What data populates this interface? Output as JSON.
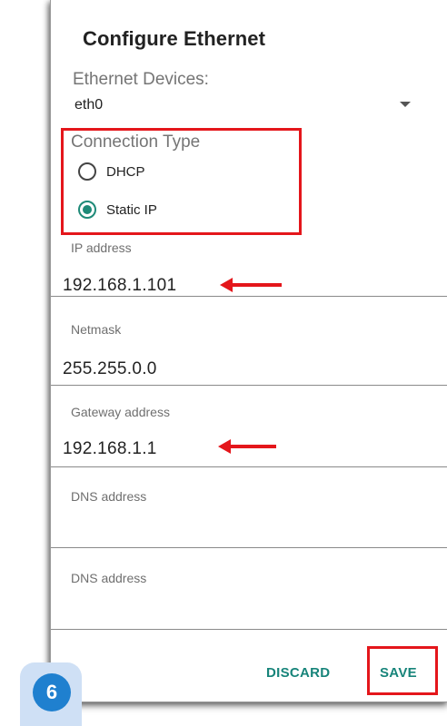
{
  "dialog": {
    "title": "Configure Ethernet",
    "devices_label": "Ethernet Devices:",
    "devices_value": "eth0",
    "connection_type_label": "Connection Type",
    "options": [
      {
        "label": "DHCP",
        "checked": false
      },
      {
        "label": "Static IP",
        "checked": true
      }
    ],
    "fields": [
      {
        "label": "IP address",
        "value": "192.168.1.101"
      },
      {
        "label": "Netmask",
        "value": "255.255.0.0"
      },
      {
        "label": "Gateway address",
        "value": "192.168.1.1"
      },
      {
        "label": "DNS address",
        "value": ""
      },
      {
        "label": "DNS address",
        "value": ""
      }
    ],
    "discard_label": "DISCARD",
    "save_label": "SAVE"
  },
  "step_badge": {
    "number": "6"
  },
  "colors": {
    "accent": "#17847a",
    "annotation_red": "#e4161b",
    "badge_blue": "#1f80cf",
    "badge_bg": "#cfe0f5"
  }
}
